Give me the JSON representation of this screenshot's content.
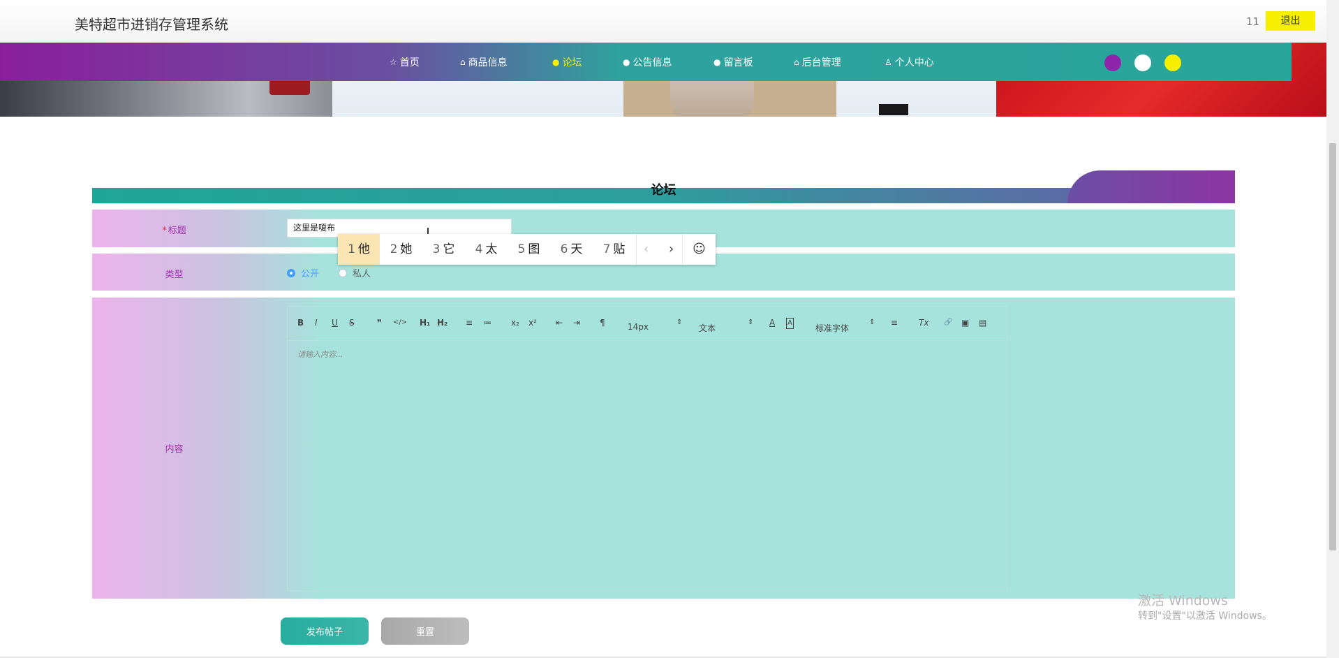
{
  "header": {
    "app_title": "美特超市进销存管理系统",
    "user_name": "11",
    "logout_label": "退出"
  },
  "nav": {
    "items": [
      {
        "icon": "☆",
        "label": "首页"
      },
      {
        "icon": "⌂",
        "label": "商品信息"
      },
      {
        "icon": "●",
        "label": "论坛"
      },
      {
        "icon": "●",
        "label": "公告信息"
      },
      {
        "icon": "●",
        "label": "留言板"
      },
      {
        "icon": "⌂",
        "label": "后台管理"
      },
      {
        "icon": "♙",
        "label": "个人中心"
      }
    ],
    "active_index": 2,
    "theme_colors": [
      "#8e24aa",
      "#ffffff",
      "#f7ef00"
    ]
  },
  "page": {
    "section_title": "论坛"
  },
  "form": {
    "title_label": "标题",
    "title_required_mark": "*",
    "title_value": "这里是嗄布",
    "type_label": "类型",
    "type_options": [
      "公开",
      "私人"
    ],
    "type_selected": "公开",
    "content_label": "内容",
    "content_placeholder": "请输入内容...",
    "submit_label": "发布帖子",
    "reset_label": "重置"
  },
  "editor_toolbar": {
    "bold": "B",
    "italic": "I",
    "underline": "U",
    "strike": "S",
    "quote": "❞",
    "code": "</>",
    "h1": "H₁",
    "h2": "H₂",
    "ordered_list": "≡",
    "bullet_list": "≔",
    "subscript": "x₂",
    "superscript": "x²",
    "outdent": "⇤",
    "indent": "⇥",
    "direction": "¶",
    "font_size": "14px",
    "text_type": "文本",
    "font_family": "标准字体",
    "color": "A",
    "background": "A",
    "align": "≡",
    "clean": "Tx",
    "link": "🔗",
    "image": "▣",
    "video": "▤"
  },
  "ime": {
    "candidates": [
      {
        "num": "1",
        "text": "他"
      },
      {
        "num": "2",
        "text": "她"
      },
      {
        "num": "3",
        "text": "它"
      },
      {
        "num": "4",
        "text": "太"
      },
      {
        "num": "5",
        "text": "图"
      },
      {
        "num": "6",
        "text": "天"
      },
      {
        "num": "7",
        "text": "贴"
      }
    ],
    "prev": "‹",
    "next": "›",
    "emoji": "☺"
  },
  "watermark": {
    "line1": "激活 Windows",
    "line2": "转到\"设置\"以激活 Windows。"
  }
}
